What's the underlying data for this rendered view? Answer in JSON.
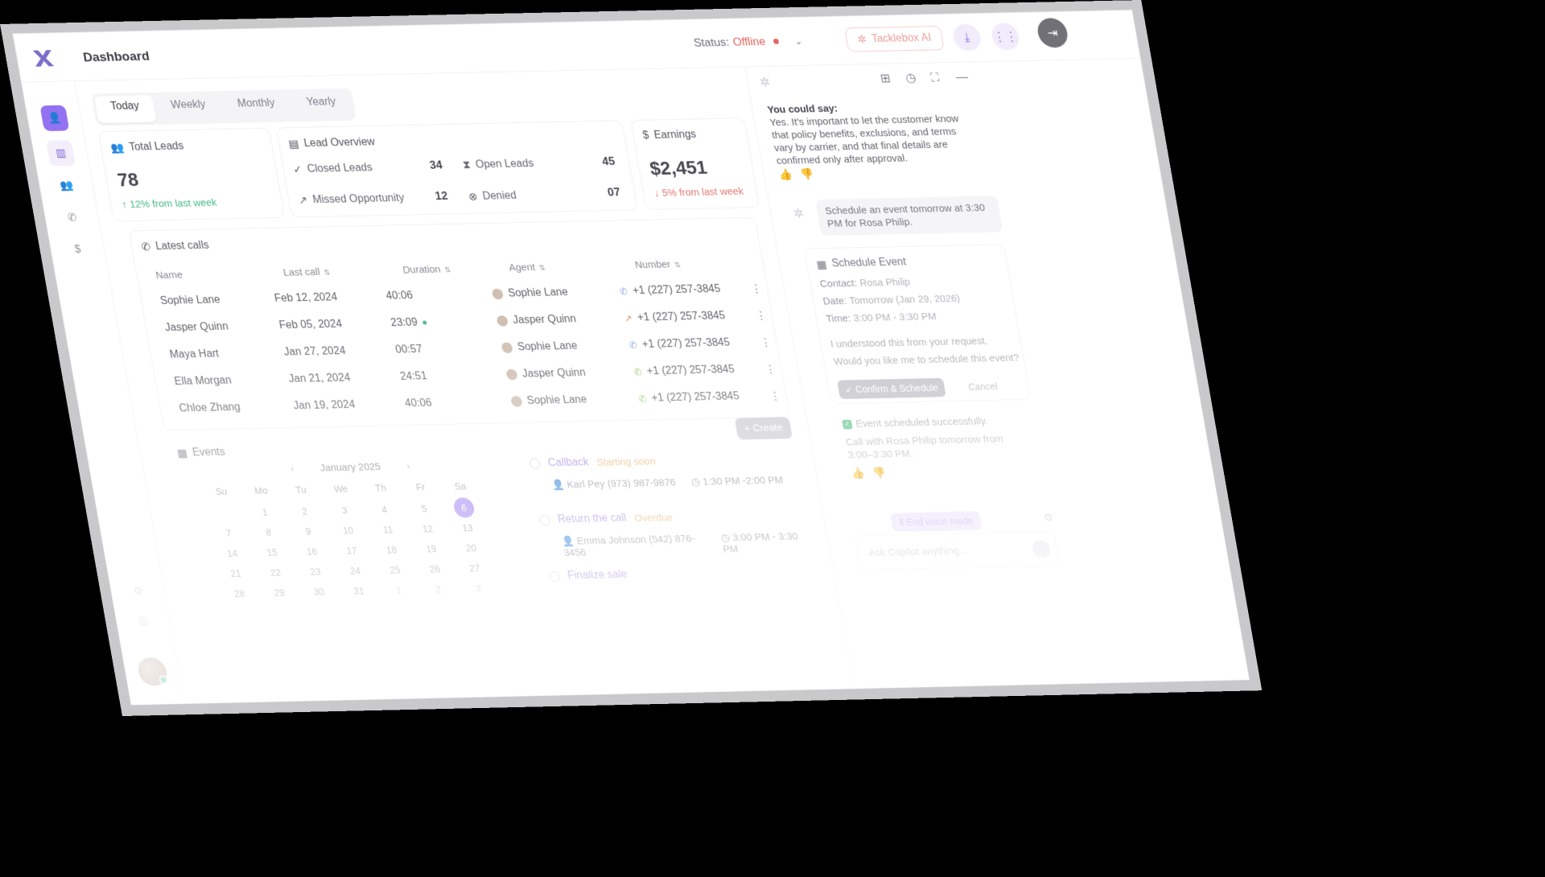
{
  "header": {
    "title": "Dashboard",
    "status_label": "Status:",
    "status_value": "Offline",
    "ai_button": "Tacklebox AI"
  },
  "tabs": [
    "Today",
    "Weekly",
    "Monthly",
    "Yearly"
  ],
  "active_tab": "Today",
  "total_leads": {
    "label": "Total Leads",
    "value": "78",
    "delta": "↑ 12% from last week"
  },
  "lead_overview": {
    "label": "Lead Overview",
    "closed_label": "Closed Leads",
    "closed": "34",
    "open_label": "Open Leads",
    "open": "45",
    "missed_label": "Missed Opportunity",
    "missed": "12",
    "denied_label": "Denied",
    "denied": "07"
  },
  "earnings": {
    "label": "Earnings",
    "value": "$2,451",
    "delta": "↓ 5% from last week"
  },
  "calls": {
    "title": "Latest calls",
    "headers": {
      "name": "Name",
      "last_call": "Last call",
      "duration": "Duration",
      "agent": "Agent",
      "number": "Number"
    },
    "rows": [
      {
        "name": "Sophie Lane",
        "last_call": "Feb 12, 2024",
        "duration": "40:06",
        "agent": "Sophie Lane",
        "number": "+1 (227) 257-3845"
      },
      {
        "name": "Jasper Quinn",
        "last_call": "Feb 05, 2024",
        "duration": "23:09",
        "agent": "Jasper Quinn",
        "number": "+1 (227) 257-3845"
      },
      {
        "name": "Maya Hart",
        "last_call": "Jan 27, 2024",
        "duration": "00:57",
        "agent": "Sophie Lane",
        "number": "+1 (227) 257-3845"
      },
      {
        "name": "Ella Morgan",
        "last_call": "Jan 21, 2024",
        "duration": "24:51",
        "agent": "Jasper Quinn",
        "number": "+1 (227) 257-3845"
      },
      {
        "name": "Chloe Zhang",
        "last_call": "Jan 19, 2024",
        "duration": "40:06",
        "agent": "Sophie Lane",
        "number": "+1 (227) 257-3845"
      }
    ]
  },
  "events": {
    "title": "Events",
    "create": "+ Create",
    "month": "January 2025",
    "dow": [
      "Su",
      "Mo",
      "Tu",
      "We",
      "Th",
      "Fr",
      "Sa"
    ],
    "weeks": [
      [
        "",
        "1",
        "2",
        "3",
        "4",
        "5",
        "6"
      ],
      [
        "7",
        "8",
        "9",
        "10",
        "11",
        "12",
        "13"
      ],
      [
        "14",
        "15",
        "16",
        "17",
        "18",
        "19",
        "20"
      ],
      [
        "21",
        "22",
        "23",
        "24",
        "25",
        "26",
        "27"
      ],
      [
        "28",
        "29",
        "30",
        "31",
        "1",
        "2",
        "3"
      ]
    ],
    "today": "6",
    "items": [
      {
        "title": "Callback",
        "tag": "Starting soon",
        "person": "Karl Pey",
        "phone": "(973) 987-9876",
        "time": "1:30 PM -2:00 PM"
      },
      {
        "title": "Return the call",
        "tag": "Overdue",
        "person": "Emma Johnson",
        "phone": "(542) 876-3456",
        "time": "3:00 PM - 3:30 PM"
      },
      {
        "title": "Finalize sale",
        "tag": "",
        "person": "",
        "phone": "",
        "time": ""
      }
    ]
  },
  "copilot": {
    "ai_label": "You could say:",
    "ai_text": "Yes. It's important to let the customer know that policy benefits, exclusions, and terms vary by carrier, and that final details are confirmed only after approval.",
    "user_msg": "Schedule an event tomorrow at 3:30 PM for Rosa Philip.",
    "sched_title": "Schedule Event",
    "contact_label": "Contact:",
    "contact": "Rosa Philip",
    "date_label": "Date:",
    "date": "Tomorrow (Jan 29, 2026)",
    "time_label": "Time:",
    "time": "3:00 PM - 3:30 PM",
    "understood": "I understood this from your request.",
    "question": "Would you like me to schedule this event?",
    "confirm": "✓ Confirm & Schedule",
    "cancel": "Cancel",
    "success": "Event scheduled successfully.",
    "success_detail": "Call with Rosa Philip tomorrow from 3:00–3:30 PM.",
    "voice": "End voice mode",
    "placeholder": "Ask Copilot anything..."
  },
  "colors": {
    "accent": "#8e6cf0",
    "danger": "#e26a63",
    "success": "#35b27a",
    "warning": "#e7a45a"
  }
}
